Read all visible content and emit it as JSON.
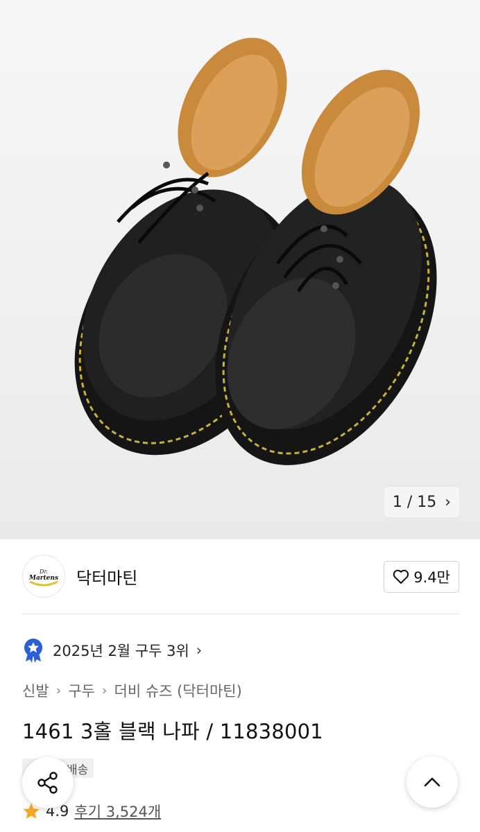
{
  "gallery": {
    "counter_text": "1 / 15",
    "current": 1,
    "total": 15
  },
  "brand": {
    "name": "닥터마틴",
    "logo_text": "Dr. Martens",
    "likes": "9.4만"
  },
  "ranking": {
    "text": "2025년 2월 구두 3위"
  },
  "breadcrumb": {
    "items": [
      "신발",
      "구두",
      "더비 슈즈 (닥터마틴)"
    ]
  },
  "product": {
    "title": "1461 3홀 블랙 나파 / 11838001",
    "tag": "배송"
  },
  "rating": {
    "score": "4.9",
    "reviews": "후기 3,524개"
  },
  "colors": {
    "star": "#f5a623",
    "badge_blue": "#2b5fd9",
    "stitch": "#d8c43a"
  },
  "icons": {
    "like": "heart-outline-icon",
    "share": "share-icon",
    "scroll_top": "chevron-up-icon",
    "next": "chevron-right-icon"
  }
}
